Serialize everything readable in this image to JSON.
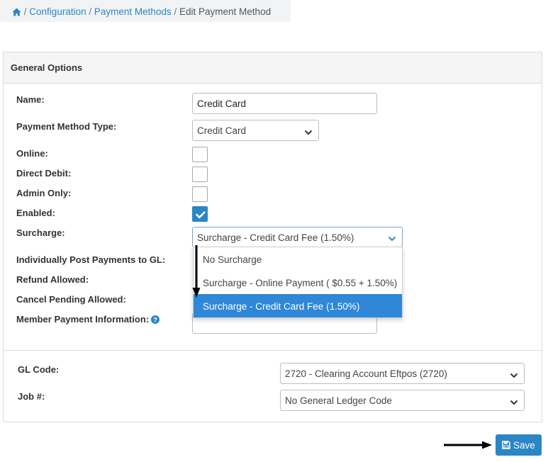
{
  "breadcrumb": {
    "home_icon": "home-icon",
    "sep": "/",
    "items": [
      "Configuration",
      "Payment Methods",
      "Edit Payment Method"
    ]
  },
  "panel": {
    "title": "General Options"
  },
  "fields": {
    "name": {
      "label": "Name:",
      "value": "Credit Card"
    },
    "payment_method_type": {
      "label": "Payment Method Type:",
      "value": "Credit Card"
    },
    "online": {
      "label": "Online:",
      "checked": false
    },
    "direct_debit": {
      "label": "Direct Debit:",
      "checked": false
    },
    "admin_only": {
      "label": "Admin Only:",
      "checked": false
    },
    "enabled": {
      "label": "Enabled:",
      "checked": true
    },
    "surcharge": {
      "label": "Surcharge:",
      "value": "Surcharge - Credit Card Fee (1.50%)",
      "options": [
        "No Surcharge",
        "Surcharge - Online Payment ( $0.55 + 1.50%)",
        "Surcharge - Credit Card Fee (1.50%)"
      ],
      "selected_index": 2
    },
    "post_to_gl": {
      "label": "Individually Post Payments to GL:"
    },
    "refund_allowed": {
      "label": "Refund Allowed:"
    },
    "cancel_pending": {
      "label": "Cancel Pending Allowed:"
    },
    "member_payment_info": {
      "label": "Member Payment Information:",
      "help_icon": "help-icon",
      "value": ""
    },
    "gl_code": {
      "label": "GL Code:",
      "value": "2720 - Clearing Account Eftpos (2720)"
    },
    "job": {
      "label": "Job #:",
      "value": "No General Ledger Code"
    }
  },
  "actions": {
    "save_label": "Save",
    "save_icon": "floppy-disk-icon"
  },
  "colors": {
    "accent": "#2b86c5",
    "selected_option": "#2f87d8",
    "link": "#2b86c5"
  }
}
